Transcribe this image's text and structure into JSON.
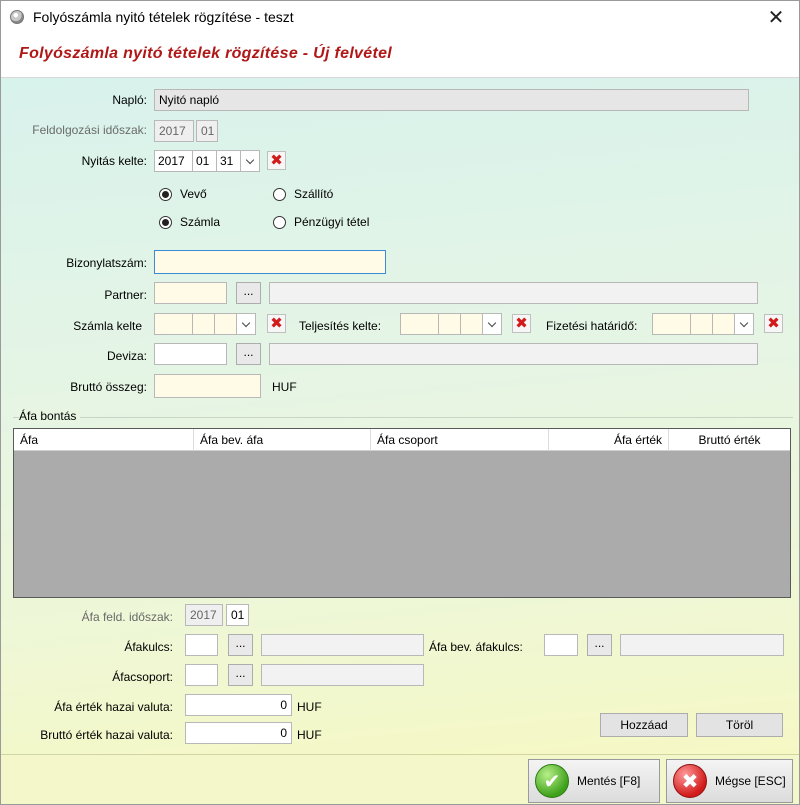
{
  "window": {
    "title": "Folyószámla nyitó tételek rögzítése - teszt"
  },
  "header": {
    "title": "Folyószámla nyitó tételek rögzítése - Új felvétel"
  },
  "form": {
    "naplo": {
      "label": "Napló:",
      "value": "Nyitó napló"
    },
    "feldolgozasi": {
      "label": "Feldolgozási időszak:",
      "year": "2017",
      "month": "01"
    },
    "nyitas": {
      "label": "Nyitás kelte:",
      "year": "2017",
      "month": "01",
      "day": "31"
    },
    "radios": {
      "vevo": "Vevő",
      "szallito": "Szállító",
      "szamla": "Számla",
      "penzugyi": "Pénzügyi tétel"
    },
    "bizonylat": {
      "label": "Bizonylatszám:",
      "value": ""
    },
    "partner": {
      "label": "Partner:",
      "dots": "..."
    },
    "szamla_kelte": {
      "label": "Számla kelte"
    },
    "teljesites": {
      "label": "Teljesítés kelte:"
    },
    "fizetesi": {
      "label": "Fizetési határidő:"
    },
    "deviza": {
      "label": "Deviza:",
      "dots": "..."
    },
    "brutto": {
      "label": "Bruttó összeg:",
      "unit": "HUF"
    }
  },
  "afa_group": {
    "label": "Áfa bontás",
    "columns": [
      "Áfa",
      "Áfa bev. áfa",
      "Áfa csoport",
      "Áfa érték",
      "Bruttó érték"
    ]
  },
  "afa_form": {
    "feld_idoszak": {
      "label": "Áfa feld. időszak:",
      "year": "2017",
      "month": "01"
    },
    "afakulcs": {
      "label": "Áfakulcs:",
      "dots": "..."
    },
    "afa_bev": {
      "label": "Áfa bev. áfakulcs:",
      "dots": "..."
    },
    "afacsoport": {
      "label": "Áfacsoport:",
      "dots": "..."
    },
    "afa_ertek": {
      "label": "Áfa érték hazai valuta:",
      "value": "0",
      "unit": "HUF"
    },
    "brutto_ertek": {
      "label": "Bruttó érték hazai valuta:",
      "value": "0",
      "unit": "HUF"
    },
    "add_button": "Hozzáad",
    "delete_button": "Töröl"
  },
  "footer": {
    "save": "Mentés [F8]",
    "cancel": "Mégse [ESC]"
  }
}
